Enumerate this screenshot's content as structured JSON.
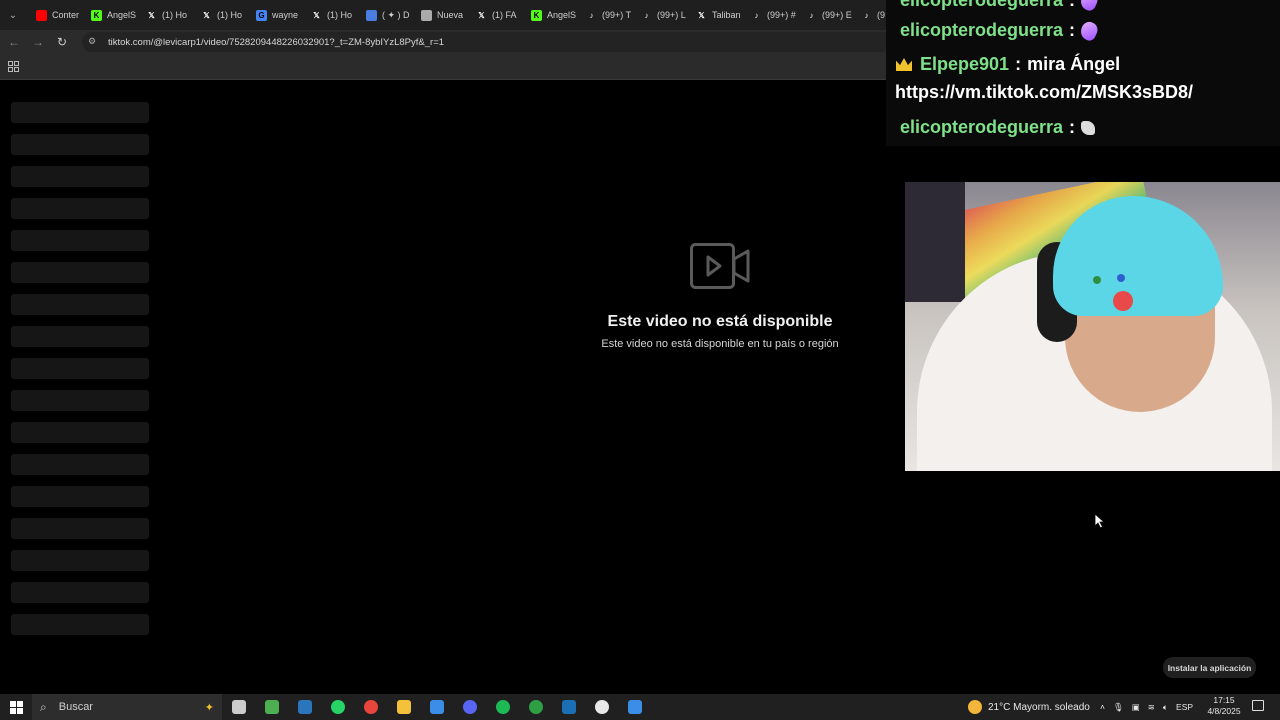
{
  "browser": {
    "tabs": [
      {
        "label": "Conter",
        "icon": "youtube-icon",
        "color": "#ff0000"
      },
      {
        "label": "AngelS",
        "icon": "kick-icon",
        "color": "#53fc18"
      },
      {
        "label": "(1) Ho",
        "icon": "x-icon",
        "color": "#ffffff"
      },
      {
        "label": "(1) Ho",
        "icon": "x-icon",
        "color": "#ffffff"
      },
      {
        "label": "wayne",
        "icon": "google-icon",
        "color": "#4285f4"
      },
      {
        "label": "(1) Ho",
        "icon": "x-icon",
        "color": "#ffffff"
      },
      {
        "label": "( ✦ ) D",
        "icon": "app-icon",
        "color": "#4a7de0"
      },
      {
        "label": "Nueva",
        "icon": "chrome-icon",
        "color": "#aaaaaa"
      },
      {
        "label": "(1) FA",
        "icon": "x-icon",
        "color": "#ffffff"
      },
      {
        "label": "AngelS",
        "icon": "kick-icon",
        "color": "#53fc18"
      },
      {
        "label": "(99+) T",
        "icon": "tiktok-icon",
        "color": "#ffffff"
      },
      {
        "label": "(99+) L",
        "icon": "tiktok-icon",
        "color": "#ffffff"
      },
      {
        "label": "Taliban",
        "icon": "x-icon",
        "color": "#ffffff"
      },
      {
        "label": "(99+) #",
        "icon": "tiktok-icon",
        "color": "#ffffff"
      },
      {
        "label": "(99+) E",
        "icon": "tiktok-icon",
        "color": "#ffffff"
      },
      {
        "label": "(9",
        "icon": "tiktok-icon",
        "color": "#ffffff"
      }
    ],
    "url": "tiktok.com/@levicarp1/video/7528209448226032901?_t=ZM-8ybIYzL8Pyf&_r=1"
  },
  "page": {
    "unavailable_title": "Este video no está disponible",
    "unavailable_subtitle": "Este video no está disponible en tu país o región",
    "install_button": "Instalar la aplicación",
    "skeleton_rows": 17
  },
  "overlay": {
    "chat": [
      {
        "user": "elicopterodeguerra",
        "sep": ":",
        "message": "",
        "emote": "feather-emote"
      },
      {
        "user": "elicopterodeguerra",
        "sep": ":",
        "message": "",
        "emote": "feather-emote"
      },
      {
        "user": "Elpepe901",
        "sep": ":",
        "message": "mira Ángel",
        "badge": "crown-icon"
      },
      {
        "user": "elicopterodeguerra",
        "sep": ":",
        "message": "",
        "emote": "hands-emote"
      }
    ],
    "chat_url": "https://vm.tiktok.com/ZMSK3sBD8/",
    "user_color": "#7fe08a"
  },
  "taskbar": {
    "search_placeholder": "Buscar",
    "weather": "21°C  Mayorm. soleado",
    "language": "ESP",
    "time": "17:15",
    "date": "4/8/2025",
    "apps": [
      {
        "name": "task-view-icon",
        "color": "#cccccc"
      },
      {
        "name": "minecraft-icon",
        "color": "#4caf50"
      },
      {
        "name": "steam-icon",
        "color": "#2a75bb"
      },
      {
        "name": "whatsapp-icon",
        "color": "#25d366"
      },
      {
        "name": "chrome-icon",
        "color": "#e8453c"
      },
      {
        "name": "file-explorer-icon",
        "color": "#f3c13a"
      },
      {
        "name": "app-icon",
        "color": "#3a8ee6"
      },
      {
        "name": "discord-icon",
        "color": "#5865f2"
      },
      {
        "name": "spotify-icon",
        "color": "#1db954"
      },
      {
        "name": "xbox-icon",
        "color": "#2ea043"
      },
      {
        "name": "steam-icon",
        "color": "#1b6fb5"
      },
      {
        "name": "obs-icon",
        "color": "#e8e8e8"
      },
      {
        "name": "app-icon",
        "color": "#3a8ee6"
      }
    ]
  }
}
